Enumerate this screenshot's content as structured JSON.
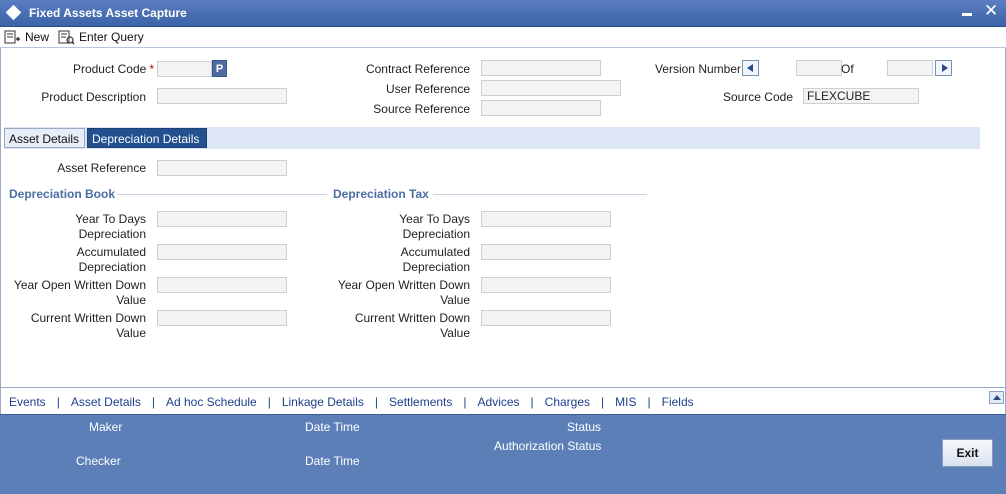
{
  "window": {
    "title": "Fixed Assets Asset Capture"
  },
  "toolbar": {
    "new_label": "New",
    "enter_query_label": "Enter Query"
  },
  "header_fields": {
    "product_code": {
      "label": "Product Code",
      "required": "*",
      "value": "",
      "lookup_label": "P"
    },
    "product_description": {
      "label": "Product Description",
      "value": ""
    },
    "contract_reference": {
      "label": "Contract Reference",
      "value": ""
    },
    "user_reference": {
      "label": "User Reference",
      "value": ""
    },
    "source_reference": {
      "label": "Source Reference",
      "value": ""
    },
    "version_number": {
      "label": "Version Number",
      "value": "",
      "of_label": "Of",
      "of_value": ""
    },
    "source_code": {
      "label": "Source Code",
      "value": "FLEXCUBE"
    }
  },
  "tabs": [
    {
      "label": "Asset Details"
    },
    {
      "label": "Depreciation Details"
    }
  ],
  "depreciation": {
    "asset_reference": {
      "label": "Asset Reference",
      "value": ""
    },
    "book": {
      "title": "Depreciation Book",
      "ytd_label_1": "Year To Days",
      "ytd_label_2": "Depreciation",
      "acc_label_1": "Accumulated",
      "acc_label_2": "Depreciation",
      "yowdv_label_1": "Year Open Written Down",
      "yowdv_label_2": "Value",
      "cwdv_label_1": "Current Written Down",
      "cwdv_label_2": "Value"
    },
    "tax": {
      "title": "Depreciation Tax",
      "ytd_label_1": "Year To Days",
      "ytd_label_2": "Depreciation",
      "acc_label_1": "Accumulated",
      "acc_label_2": "Depreciation",
      "yowdv_label_1": "Year Open Written Down",
      "yowdv_label_2": "Value",
      "cwdv_label_1": "Current Written Down",
      "cwdv_label_2": "Value"
    }
  },
  "bottom_links": [
    "Events",
    "Asset Details",
    "Ad hoc Schedule",
    "Linkage Details",
    "Settlements",
    "Advices",
    "Charges",
    "MIS",
    "Fields"
  ],
  "link_separator": "|",
  "footer": {
    "maker_label": "Maker",
    "checker_label": "Checker",
    "date_time_label_1": "Date Time",
    "date_time_label_2": "Date Time",
    "status_label": "Status",
    "authorization_status_label": "Authorization Status",
    "exit_label": "Exit"
  },
  "colors": {
    "title_bar": "#3c63a8",
    "active_tab": "#23508f",
    "footer": "#5c7fb8",
    "section_header": "#4a6ea4",
    "link": "#1d3e8c",
    "required": "#cc0000"
  }
}
